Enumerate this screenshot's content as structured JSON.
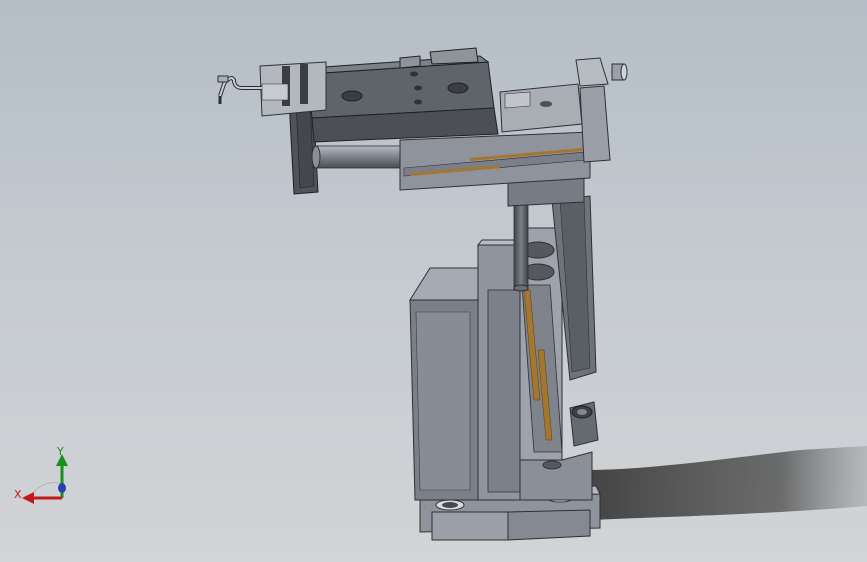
{
  "viewport": {
    "background_top": "#b4bec7",
    "background_bottom": "#d2d4d6"
  },
  "model": {
    "body_color": "#8a8f99",
    "dark_color": "#505459",
    "accent_color": "#a5772e"
  },
  "triad": {
    "x_label": "X",
    "y_label": "Y",
    "x_color": "#c21a1a",
    "y_color": "#1a8f1a",
    "z_color": "#2a3fb0"
  }
}
